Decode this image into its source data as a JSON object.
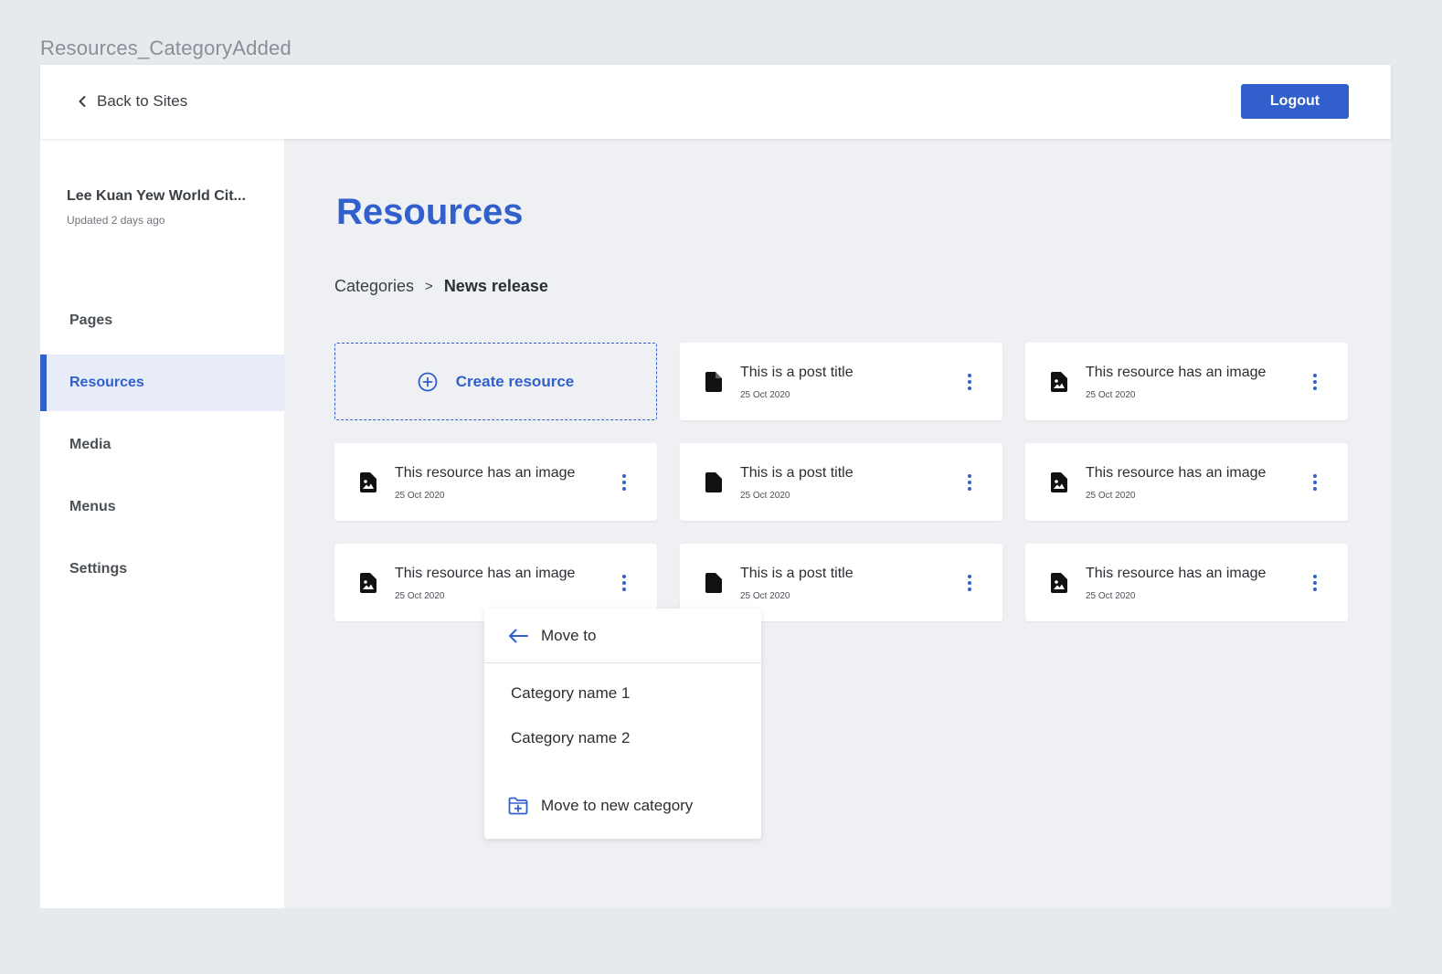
{
  "frame_title": "Resources_CategoryAdded",
  "header": {
    "back_label": "Back to Sites",
    "logout_label": "Logout"
  },
  "sidebar": {
    "site_name": "Lee Kuan Yew World Cit...",
    "site_updated": "Updated 2 days ago",
    "items": [
      {
        "label": "Pages",
        "active": false
      },
      {
        "label": "Resources",
        "active": true
      },
      {
        "label": "Media",
        "active": false
      },
      {
        "label": "Menus",
        "active": false
      },
      {
        "label": "Settings",
        "active": false
      }
    ]
  },
  "main": {
    "title": "Resources",
    "breadcrumb": {
      "parent": "Categories",
      "separator": ">",
      "current": "News release"
    },
    "create_label": "Create resource",
    "cards": [
      {
        "title": "This is a post title",
        "date": "25 Oct 2020",
        "icon": "document-icon"
      },
      {
        "title": "This resource has an image",
        "date": "25 Oct 2020",
        "icon": "image-document-icon"
      },
      {
        "title": "This resource has an image",
        "date": "25 Oct 2020",
        "icon": "image-document-icon"
      },
      {
        "title": "This is a post title",
        "date": "25 Oct 2020",
        "icon": "document-icon"
      },
      {
        "title": "This resource has an image",
        "date": "25 Oct 2020",
        "icon": "image-document-icon"
      },
      {
        "title": "This resource has an image",
        "date": "25 Oct 2020",
        "icon": "image-document-icon"
      },
      {
        "title": "This is a post title",
        "date": "25 Oct 2020",
        "icon": "document-icon"
      },
      {
        "title": "This resource has an image",
        "date": "25 Oct 2020",
        "icon": "image-document-icon"
      }
    ]
  },
  "move_menu": {
    "title": "Move to",
    "categories": [
      "Category name 1",
      "Category name 2"
    ],
    "new_category_label": "Move to new category"
  },
  "colors": {
    "accent": "#3160cc",
    "page_bg": "#e6e9ed",
    "content_bg": "#eef0f3",
    "active_nav_bg": "#e7ecf8"
  }
}
